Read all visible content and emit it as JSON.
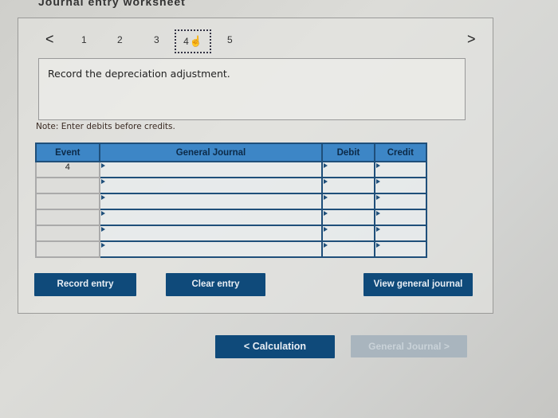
{
  "header": {
    "partial_title": "Journal entry worksheet"
  },
  "pager": {
    "prev_icon": "chevron-left-icon",
    "next_icon": "chevron-right-icon",
    "prev_glyph": "<",
    "next_glyph": ">",
    "pages": [
      "1",
      "2",
      "3",
      "4",
      "5"
    ],
    "active_page": "4",
    "cursor_glyph": "☝"
  },
  "instruction": "Record the depreciation adjustment.",
  "note": "Note: Enter debits before credits.",
  "table": {
    "headers": [
      "Event",
      "General Journal",
      "Debit",
      "Credit"
    ],
    "rows": [
      {
        "event": "4",
        "account": "",
        "debit": "",
        "credit": ""
      },
      {
        "event": "",
        "account": "",
        "debit": "",
        "credit": ""
      },
      {
        "event": "",
        "account": "",
        "debit": "",
        "credit": ""
      },
      {
        "event": "",
        "account": "",
        "debit": "",
        "credit": ""
      },
      {
        "event": "",
        "account": "",
        "debit": "",
        "credit": ""
      },
      {
        "event": "",
        "account": "",
        "debit": "",
        "credit": ""
      }
    ]
  },
  "buttons": {
    "record": "Record entry",
    "clear": "Clear entry",
    "view": "View general journal"
  },
  "nav": {
    "prev_label": "<   Calculation",
    "next_label": "General Journal   >"
  },
  "colors": {
    "primary_button": "#0f4a7a",
    "table_header": "#3d86c6",
    "disabled_button": "#a9b5be"
  }
}
